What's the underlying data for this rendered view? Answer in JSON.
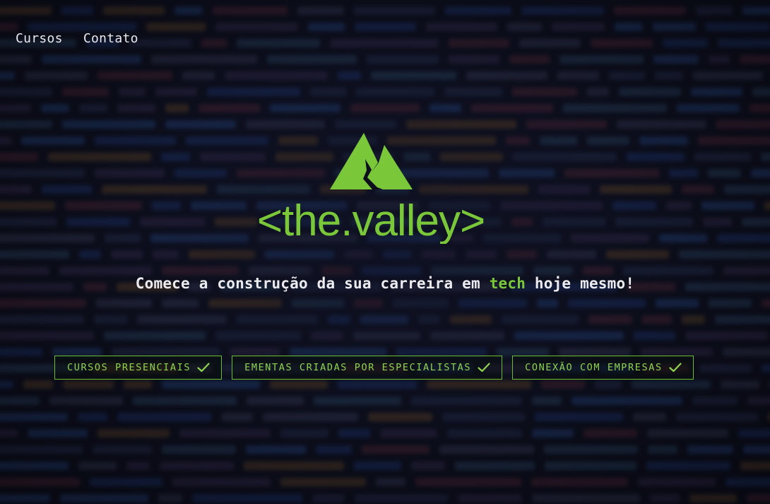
{
  "nav": {
    "items": [
      {
        "label": "Cursos"
      },
      {
        "label": "Contato"
      }
    ]
  },
  "logo": {
    "text": "<the.valley>",
    "color": "#7ac83a"
  },
  "hero": {
    "headline_before": "Comece a construção da sua carreira em ",
    "headline_accent": "tech",
    "headline_after": " hoje mesmo!"
  },
  "features": [
    {
      "label": "CURSOS PRESENCIAIS",
      "icon": "check-icon"
    },
    {
      "label": "EMENTAS CRIADAS POR ESPECIALISTAS",
      "icon": "check-icon"
    },
    {
      "label": "CONEXÃO COM EMPRESAS",
      "icon": "check-icon"
    }
  ],
  "colors": {
    "accent": "#7ac83a",
    "background": "#0d0f1c",
    "text": "#ececf0"
  }
}
